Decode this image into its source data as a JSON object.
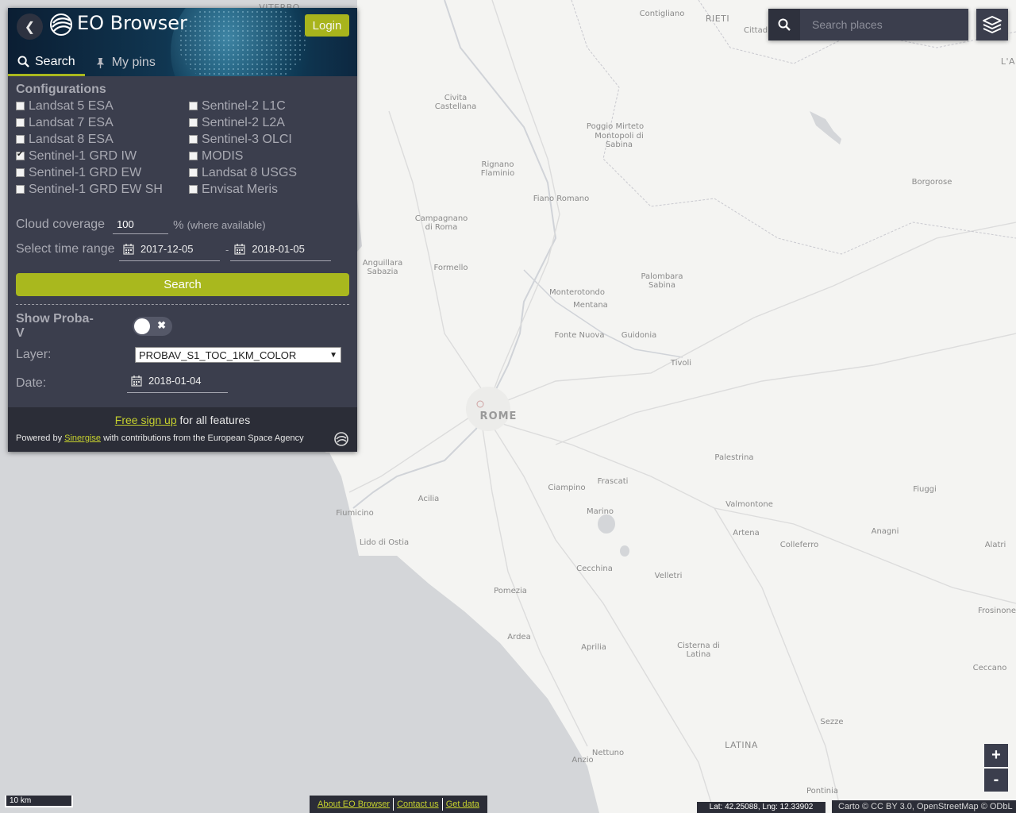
{
  "header": {
    "app_title": "EO Browser",
    "login_label": "Login",
    "tabs": [
      {
        "label": "Search",
        "icon": "search-icon",
        "active": true
      },
      {
        "label": "My pins",
        "icon": "pin-icon",
        "active": false
      }
    ]
  },
  "configurations": {
    "title": "Configurations",
    "items": [
      {
        "label": "Landsat 5 ESA",
        "checked": false
      },
      {
        "label": "Sentinel-2 L1C",
        "checked": false
      },
      {
        "label": "Landsat 7 ESA",
        "checked": false
      },
      {
        "label": "Sentinel-2 L2A",
        "checked": false
      },
      {
        "label": "Landsat 8 ESA",
        "checked": false
      },
      {
        "label": "Sentinel-3 OLCI",
        "checked": false
      },
      {
        "label": "Sentinel-1 GRD IW",
        "checked": true
      },
      {
        "label": "MODIS",
        "checked": false
      },
      {
        "label": "Sentinel-1 GRD EW",
        "checked": false
      },
      {
        "label": "Landsat 8 USGS",
        "checked": false
      },
      {
        "label": "Sentinel-1 GRD EW SH",
        "checked": false
      },
      {
        "label": "Envisat Meris",
        "checked": false
      }
    ]
  },
  "cloud": {
    "label": "Cloud coverage",
    "value": "100",
    "unit": "%",
    "note": "(where available)"
  },
  "time_range": {
    "label": "Select time range",
    "from": "2017-12-05",
    "separator": "-",
    "to": "2018-01-05"
  },
  "search_label": "Search",
  "proba": {
    "label": "Show Proba-V",
    "enabled": false,
    "layer_label": "Layer:",
    "layer_value": "PROBAV_S1_TOC_1KM_COLOR",
    "date_label": "Date:",
    "date_value": "2018-01-04"
  },
  "footer": {
    "signup_link": "Free sign up",
    "signup_rest": "for all features",
    "powered_prefix": "Powered by",
    "powered_link": "Sinergise",
    "powered_suffix": "with contributions from the European Space Agency"
  },
  "search_places": {
    "placeholder": "Search places"
  },
  "zoom": {
    "in": "+",
    "out": "-"
  },
  "scale_label": "10 km",
  "bottom_links": [
    "About EO Browser",
    "Contact us",
    "Get data"
  ],
  "coordinates": "Lat: 42.25088, Lng: 12.33902",
  "attribution": "Carto © CC BY 3.0, OpenStreetMap © ODbL",
  "map_places": [
    {
      "name": "VITERBO",
      "cls": "mid"
    },
    {
      "name": "Contigliano",
      "cls": ""
    },
    {
      "name": "RIETI",
      "cls": "mid"
    },
    {
      "name": "Cittad",
      "cls": ""
    },
    {
      "name": "L'A",
      "cls": "mid"
    },
    {
      "name": "Civita\nCastellana",
      "cls": ""
    },
    {
      "name": "Poggio Mirteto",
      "cls": ""
    },
    {
      "name": "Montopoli di\nSabina",
      "cls": ""
    },
    {
      "name": "Rignano\nFlaminio",
      "cls": ""
    },
    {
      "name": "Borgorose",
      "cls": ""
    },
    {
      "name": "Fiano Romano",
      "cls": ""
    },
    {
      "name": "Campagnano\ndi Roma",
      "cls": ""
    },
    {
      "name": "Anguillara\nSabazia",
      "cls": ""
    },
    {
      "name": "Formello",
      "cls": ""
    },
    {
      "name": "Palombara\nSabina",
      "cls": ""
    },
    {
      "name": "Monterotondo",
      "cls": ""
    },
    {
      "name": "Mentana",
      "cls": ""
    },
    {
      "name": "Fonte Nuova",
      "cls": ""
    },
    {
      "name": "Guidonia",
      "cls": ""
    },
    {
      "name": "Tivoli",
      "cls": ""
    },
    {
      "name": "ROME",
      "cls": "big"
    },
    {
      "name": "Palestrina",
      "cls": ""
    },
    {
      "name": "Frascati",
      "cls": ""
    },
    {
      "name": "Ciampino",
      "cls": ""
    },
    {
      "name": "Fiuggi",
      "cls": ""
    },
    {
      "name": "Acilia",
      "cls": ""
    },
    {
      "name": "Valmontone",
      "cls": ""
    },
    {
      "name": "Fiumicino",
      "cls": ""
    },
    {
      "name": "Marino",
      "cls": ""
    },
    {
      "name": "Anagni",
      "cls": ""
    },
    {
      "name": "Artena",
      "cls": ""
    },
    {
      "name": "Colleferro",
      "cls": ""
    },
    {
      "name": "Alatri",
      "cls": ""
    },
    {
      "name": "Lido di Ostia",
      "cls": ""
    },
    {
      "name": "Cecchina",
      "cls": ""
    },
    {
      "name": "Velletri",
      "cls": ""
    },
    {
      "name": "Pomezia",
      "cls": ""
    },
    {
      "name": "Frosinone",
      "cls": ""
    },
    {
      "name": "Ardea",
      "cls": ""
    },
    {
      "name": "Aprilia",
      "cls": ""
    },
    {
      "name": "Cisterna di\nLatina",
      "cls": ""
    },
    {
      "name": "Ceccano",
      "cls": ""
    },
    {
      "name": "Sezze",
      "cls": ""
    },
    {
      "name": "LATINA",
      "cls": "mid"
    },
    {
      "name": "Nettuno",
      "cls": ""
    },
    {
      "name": "Anzio",
      "cls": ""
    },
    {
      "name": "Pontinia",
      "cls": ""
    }
  ]
}
